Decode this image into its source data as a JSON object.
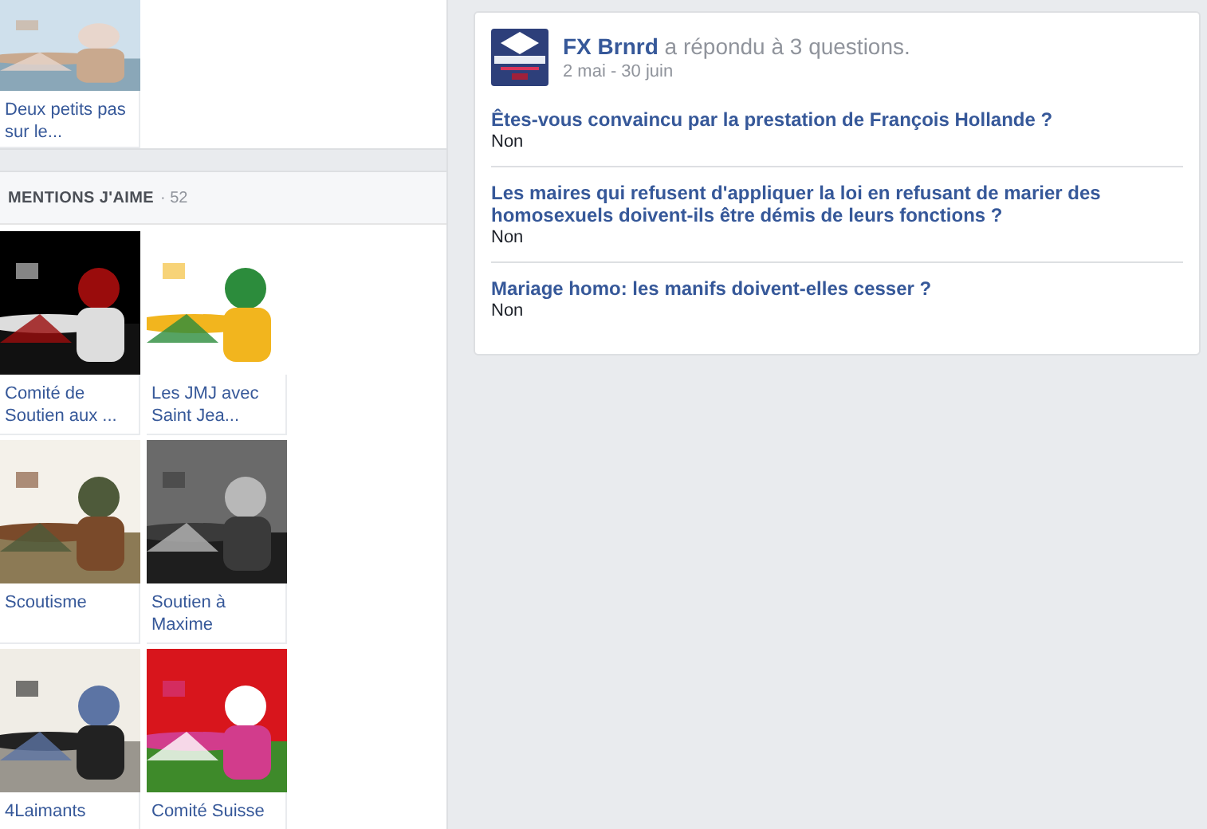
{
  "recent": {
    "tiles": [
      {
        "caption": "Deux petits pas sur le...",
        "kind": "picture"
      }
    ]
  },
  "likes": {
    "title": "MENTIONS J'AIME",
    "count": "· 52",
    "tiles": [
      {
        "caption": "Comité de Soutien aux ...",
        "kind": "picture"
      },
      {
        "caption": "Les JMJ avec Saint Jea...",
        "kind": "picture"
      },
      {
        "caption": "Scoutisme",
        "kind": "picture"
      },
      {
        "caption": "Soutien à Maxime",
        "kind": "picture"
      },
      {
        "caption": "4Laimants",
        "kind": "picture"
      },
      {
        "caption": "Comité Suisse",
        "kind": "picture"
      }
    ]
  },
  "story": {
    "author": "FX Brnrd",
    "action": "a répondu à 3 questions.",
    "date": "2 mai - 30 juin",
    "questions": [
      {
        "question": "Êtes-vous convaincu par la prestation de François Hollande ?",
        "answer": "Non"
      },
      {
        "question": "Les maires qui refusent d'appliquer la loi en refusant de marier des homosexuels doivent-ils être démis de leurs fonctions ?",
        "answer": "Non"
      },
      {
        "question": "Mariage homo: les manifs doivent-elles cesser ?",
        "answer": "Non"
      }
    ]
  }
}
